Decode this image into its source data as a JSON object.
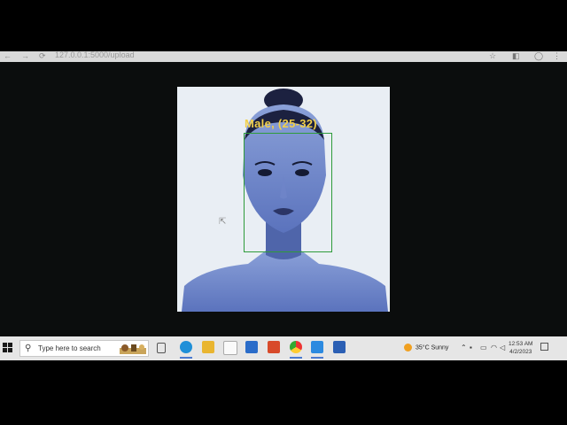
{
  "browser": {
    "url": "127.0.0.1:5000/upload",
    "back_icon": "back-arrow-icon",
    "forward_icon": "forward-arrow-icon",
    "reload_icon": "reload-icon"
  },
  "detection": {
    "label": "Male, (25-32)",
    "box_color": "#2e9b3a",
    "label_color": "#f2d04a"
  },
  "taskbar": {
    "search_placeholder": "Type here to search",
    "weather_text": "35°C  Sunny",
    "time": "12:53 AM",
    "date": "4/2/2023",
    "apps": [
      "task-view",
      "edge",
      "file-explorer",
      "calendar",
      "mail",
      "office",
      "chrome",
      "vscode",
      "word"
    ]
  }
}
